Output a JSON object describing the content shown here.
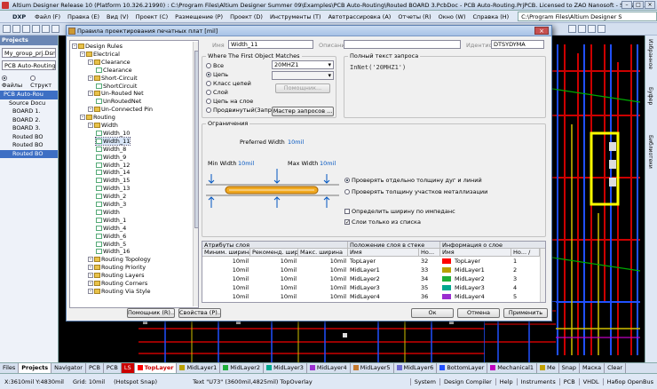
{
  "window": {
    "title": "Altium Designer Release 10 (Platform 10.326.21990) : C:\\Program Files\\Altium Designer Summer 09\\Examples\\PCB Auto-Routing\\Routed BOARD 3.PcbDoc - PCB Auto-Routing.PrjPCB. Licensed to ZAO Nanosoft - Subscri..."
  },
  "menu": {
    "items": [
      "DXP",
      "Файл (F)",
      "Правка (E)",
      "Вид (V)",
      "Проект (C)",
      "Размещение (P)",
      "Проект (D)",
      "Инструменты (T)",
      "Автотрассировка (A)",
      "Отчеты (R)",
      "Окно (W)",
      "Справка (H)"
    ],
    "path": "C:\\Program Files\\Altium Designer S"
  },
  "left_panel": {
    "title": "Projects",
    "workspace": "My_group_prj.DsnWrk",
    "project": "PCB Auto-Routing.PrjP",
    "radio_files": "Файлы",
    "radio_structure": "Структ",
    "tree": [
      "PCB Auto-Rou",
      "Source Docu",
      "BOARD 1.",
      "BOARD 2.",
      "BOARD 3.",
      "Routed BO",
      "Routed BO",
      "Routed BO"
    ]
  },
  "right_strip": [
    "Избранное",
    "Буфер",
    "Библиотеки"
  ],
  "dialog": {
    "title": "Правила проектирования печатных плат [mil]",
    "tree": [
      {
        "label": "Design Rules",
        "level": 0,
        "icon": "folder"
      },
      {
        "label": "Electrical",
        "level": 1,
        "icon": "folder"
      },
      {
        "label": "Clearance",
        "level": 2,
        "icon": "folder"
      },
      {
        "label": "Clearance",
        "level": 3,
        "icon": "rule"
      },
      {
        "label": "Short-Circuit",
        "level": 2,
        "icon": "folder"
      },
      {
        "label": "ShortCircuit",
        "level": 3,
        "icon": "rule"
      },
      {
        "label": "Un-Routed Net",
        "level": 2,
        "icon": "folder"
      },
      {
        "label": "UnRoutedNet",
        "level": 3,
        "icon": "rule"
      },
      {
        "label": "Un-Connected Pin",
        "level": 2,
        "icon": "folder"
      },
      {
        "label": "Routing",
        "level": 1,
        "icon": "folder"
      },
      {
        "label": "Width",
        "level": 2,
        "icon": "folder"
      },
      {
        "label": "Width_10",
        "level": 3,
        "icon": "rule"
      },
      {
        "label": "Width_11",
        "level": 3,
        "icon": "rule",
        "selected": true
      },
      {
        "label": "Width_8",
        "level": 3,
        "icon": "rule"
      },
      {
        "label": "Width_9",
        "level": 3,
        "icon": "rule"
      },
      {
        "label": "Width_12",
        "level": 3,
        "icon": "rule"
      },
      {
        "label": "Width_14",
        "level": 3,
        "icon": "rule"
      },
      {
        "label": "Width_15",
        "level": 3,
        "icon": "rule"
      },
      {
        "label": "Width_13",
        "level": 3,
        "icon": "rule"
      },
      {
        "label": "Width_2",
        "level": 3,
        "icon": "rule"
      },
      {
        "label": "Width_3",
        "level": 3,
        "icon": "rule"
      },
      {
        "label": "Width",
        "level": 3,
        "icon": "rule"
      },
      {
        "label": "Width_1",
        "level": 3,
        "icon": "rule"
      },
      {
        "label": "Width_4",
        "level": 3,
        "icon": "rule"
      },
      {
        "label": "Width_6",
        "level": 3,
        "icon": "rule"
      },
      {
        "label": "Width_5",
        "level": 3,
        "icon": "rule"
      },
      {
        "label": "Width_16",
        "level": 3,
        "icon": "rule"
      },
      {
        "label": "Routing Topology",
        "level": 2,
        "icon": "folder"
      },
      {
        "label": "Routing Priority",
        "level": 2,
        "icon": "folder"
      },
      {
        "label": "Routing Layers",
        "level": 2,
        "icon": "folder"
      },
      {
        "label": "Routing Corners",
        "level": 2,
        "icon": "folder"
      },
      {
        "label": "Routing Via Style",
        "level": 2,
        "icon": "folder"
      }
    ],
    "name_label": "Имя",
    "name_value": "Width_11",
    "desc_label": "Описание",
    "id_label": "Идентиф",
    "id_value": "DTSYDYMA",
    "match_group": "Where The First Object Matches",
    "match_options": [
      "Все",
      "Цепь",
      "Класс цепей",
      "Слой",
      "Цепь на слое",
      "Продвинутый(Запрос)"
    ],
    "net_value": "20MHZ1",
    "helper_button": "Помощник...",
    "query_builder_button": "Мастер запросов ...",
    "query_group": "Полный текст запроса",
    "query_text": "InNet('20MHZ1')",
    "constraints_group": "Ограничения",
    "pref_label": "Preferred Width",
    "pref_value": "10mil",
    "min_label": "Min Width",
    "min_value": "10mil",
    "max_label": "Max Width",
    "max_value": "10mil",
    "radio_check_tracks": "Проверять отдельно толщину дуг и линий",
    "radio_check_copper": "Проверять толщину участков металлизации",
    "chk_impedance": "Определить ширину по импеданс",
    "chk_stack_only": "Слои только из списка",
    "table": {
      "group1": "Атрибуты слоя",
      "group2": "Положение слоя в стеке",
      "group3": "Информация о слое",
      "cols": [
        "Миним. ширина",
        "Рекоменд. шир",
        "Макс. ширина",
        "Имя",
        "Но...",
        "Имя",
        "Но... /"
      ],
      "rows": [
        {
          "min": "10mil",
          "pref": "10mil",
          "max": "10mil",
          "name": "TopLayer",
          "num": "32",
          "lname": "TopLayer",
          "lnum": "1",
          "color": "#ff0000"
        },
        {
          "min": "10mil",
          "pref": "10mil",
          "max": "10mil",
          "name": "MidLayer1",
          "num": "33",
          "lname": "MidLayer1",
          "lnum": "2",
          "color": "#b8a000"
        },
        {
          "min": "10mil",
          "pref": "10mil",
          "max": "10mil",
          "name": "MidLayer2",
          "num": "34",
          "lname": "MidLayer2",
          "lnum": "3",
          "color": "#1fae3a"
        },
        {
          "min": "10mil",
          "pref": "10mil",
          "max": "10mil",
          "name": "MidLayer3",
          "num": "35",
          "lname": "MidLayer3",
          "lnum": "4",
          "color": "#00a890"
        },
        {
          "min": "10mil",
          "pref": "10mil",
          "max": "10mil",
          "name": "MidLayer4",
          "num": "36",
          "lname": "MidLayer4",
          "lnum": "5",
          "color": "#9a2ed0"
        }
      ]
    },
    "btn_assistant": "Помощник (R)...",
    "btn_props": "Свойства (P)...",
    "btn_ok": "Ок",
    "btn_cancel": "Отмена",
    "btn_apply": "Применить"
  },
  "bottom_tabs": {
    "panel_tabs": [
      "Files",
      "Projects",
      "Navigator",
      "PCB",
      "PCB"
    ],
    "layer_ls": "LS",
    "layers": [
      {
        "name": "TopLayer",
        "color": "#ff0000",
        "active": true
      },
      {
        "name": "MidLayer1",
        "color": "#b8a000"
      },
      {
        "name": "MidLayer2",
        "color": "#1fae3a"
      },
      {
        "name": "MidLayer3",
        "color": "#00a890"
      },
      {
        "name": "MidLayer4",
        "color": "#9a2ed0"
      },
      {
        "name": "MidLayer5",
        "color": "#c47a30"
      },
      {
        "name": "MidLayer6",
        "color": "#6a6ad0"
      },
      {
        "name": "BottomLayer",
        "color": "#2050ff"
      },
      {
        "name": "Mechanical1",
        "color": "#c000c0"
      },
      {
        "name": "Me",
        "color": "#c0a000"
      }
    ],
    "right": [
      "Snap",
      "Маска",
      "Clear"
    ]
  },
  "status": {
    "coords": "X:3610mil Y:4830mil",
    "grid": "Grid: 10mil",
    "snap": "(Hotspot Snap)",
    "text": "Text \"U73\" (3600mil,4825mil) TopOverlay",
    "buttons": [
      "System",
      "Design Compiler",
      "Help",
      "Instruments",
      "PCB",
      "VHDL",
      "Набор OpenBus"
    ]
  }
}
